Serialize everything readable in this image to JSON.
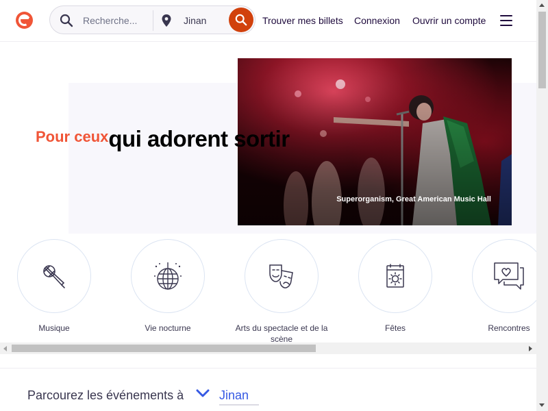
{
  "header": {
    "logo": "eventbrite-logo",
    "search": {
      "placeholder": "Recherche...",
      "value": "",
      "icon": "search-icon"
    },
    "location": {
      "value": "Jinan",
      "icon": "location-pin-icon"
    },
    "search_button_icon": "search-icon",
    "nav": [
      {
        "label": "Trouver mes billets"
      },
      {
        "label": "Connexion"
      },
      {
        "label": "Ouvrir un compte"
      }
    ],
    "menu_icon": "hamburger-menu-icon"
  },
  "hero": {
    "tagline_accent": "Pour ceux",
    "tagline_main": "qui adorent sortir",
    "photo_caption": "Superorganism, Great American Music Hall"
  },
  "categories": [
    {
      "label": "Musique",
      "icon": "microphone-icon"
    },
    {
      "label": "Vie nocturne",
      "icon": "disco-ball-icon"
    },
    {
      "label": "Arts du spectacle et de la scène",
      "icon": "theater-masks-icon"
    },
    {
      "label": "Fêtes",
      "icon": "calendar-sun-icon"
    },
    {
      "label": "Rencontres",
      "icon": "chat-heart-icon"
    }
  ],
  "browse": {
    "title": "Parcourez les événements à",
    "city": "Jinan"
  },
  "colors": {
    "brand": "#f05537",
    "search_button": "#d1410c",
    "link_blue": "#3659e3",
    "text_dark": "#1e0a3c"
  }
}
